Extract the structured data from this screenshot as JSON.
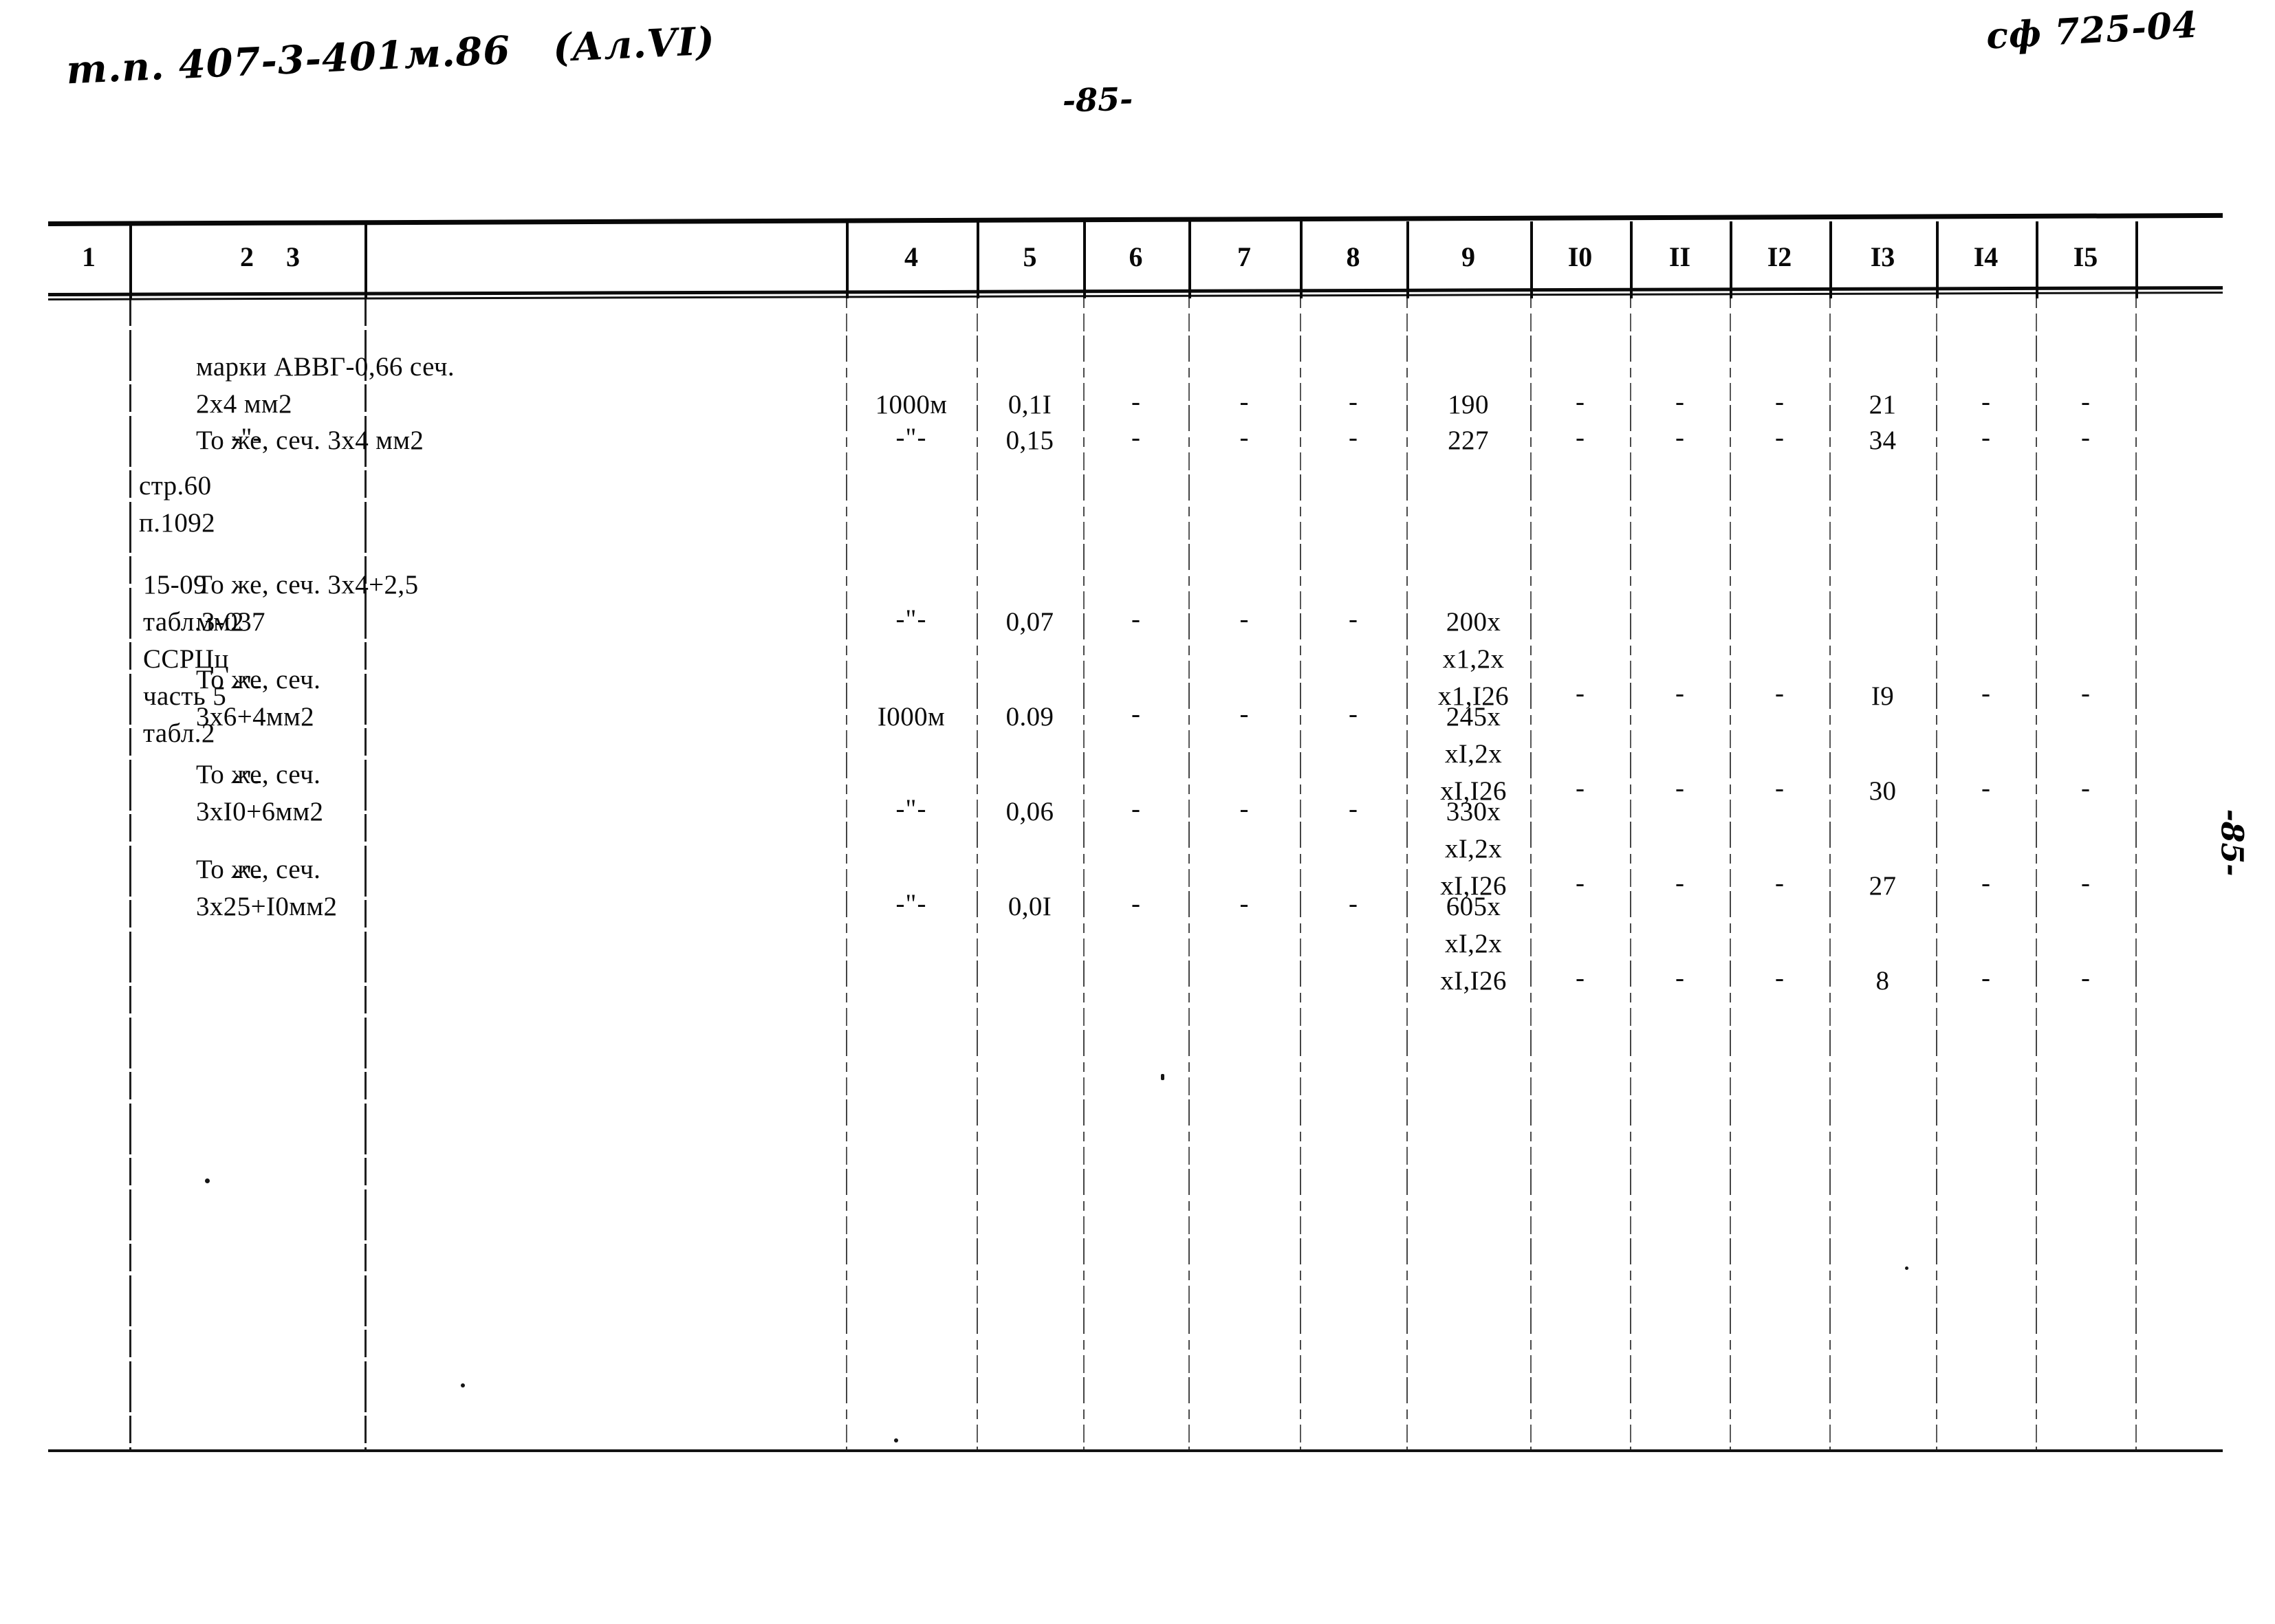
{
  "annotations": {
    "top_left_handwritten_code": "т.п. 407-3-401м.86",
    "top_left_handwritten_album": "(Ал.VI)",
    "top_right_handwritten_code": "сф 725-04",
    "page_number_top": "-85-",
    "page_number_side": "-85-"
  },
  "table": {
    "column_headers": [
      "1",
      "2",
      "3",
      "4",
      "5",
      "6",
      "7",
      "8",
      "9",
      "I0",
      "II",
      "I2",
      "I3",
      "I4",
      "I5"
    ],
    "rows": [
      {
        "col1": "",
        "col2": "",
        "col3": "марки АВВГ-0,66 сеч.\n2х4 мм2",
        "col4": "1000м",
        "col5": "0,1I",
        "col6": "-",
        "col7": "-",
        "col8": "-",
        "col9": "190",
        "col10": "-",
        "col11": "-",
        "col12": "-",
        "col13": "21",
        "col14": "-",
        "col15": "-"
      },
      {
        "col1": "",
        "col2": "-\"-",
        "col3": "То же, сеч. 3х4 мм2",
        "col4": "-\"-",
        "col5": "0,15",
        "col6": "-",
        "col7": "-",
        "col8": "-",
        "col9": "227",
        "col10": "-",
        "col11": "-",
        "col12": "-",
        "col13": "34",
        "col14": "-",
        "col15": "-"
      },
      {
        "col1": "",
        "col2": "стр.60\nп.1092",
        "col3": "",
        "col4": "",
        "col5": "",
        "col6": "",
        "col7": "",
        "col8": "",
        "col9": "",
        "col10": "",
        "col11": "",
        "col12": "",
        "col13": "",
        "col14": "",
        "col15": ""
      },
      {
        "col1": "",
        "col2": "15-09\nтабл.3-037\nССРЦц\nчасть 5\nтабл.2",
        "col3": "То же, сеч. 3х4+2,5\nмм2",
        "col4": "-\"-",
        "col5": "0,07",
        "col6": "-",
        "col7": "-",
        "col8": "-",
        "col9": "200х\nх1,2х\nх1,I26",
        "col10": "-",
        "col11": "-",
        "col12": "-",
        "col13": "I9",
        "col14": "-",
        "col15": "-"
      },
      {
        "col1": "",
        "col2": "-\"-",
        "col3": "То же, сеч.\n3х6+4мм2",
        "col4": "I000м",
        "col5": "0.09",
        "col6": "-",
        "col7": "-",
        "col8": "-",
        "col9": "245х\nхI,2х\nхI,I26",
        "col10": "-",
        "col11": "-",
        "col12": "-",
        "col13": "30",
        "col14": "-",
        "col15": "-"
      },
      {
        "col1": "",
        "col2": "-\"-",
        "col3": "То же, сеч.\n3хI0+6мм2",
        "col4": "-\"-",
        "col5": "0,06",
        "col6": "-",
        "col7": "-",
        "col8": "-",
        "col9": "330х\nхI,2х\nхI,I26",
        "col10": "-",
        "col11": "-",
        "col12": "-",
        "col13": "27",
        "col14": "-",
        "col15": "-"
      },
      {
        "col1": "",
        "col2": "-\"-",
        "col3": "То же, сеч.\n3х25+I0мм2",
        "col4": "-\"-",
        "col5": "0,0I",
        "col6": "-",
        "col7": "-",
        "col8": "-",
        "col9": "605х\nхI,2х\nхI,I26",
        "col10": "-",
        "col11": "-",
        "col12": "-",
        "col13": "8",
        "col14": "-",
        "col15": "-"
      }
    ]
  }
}
